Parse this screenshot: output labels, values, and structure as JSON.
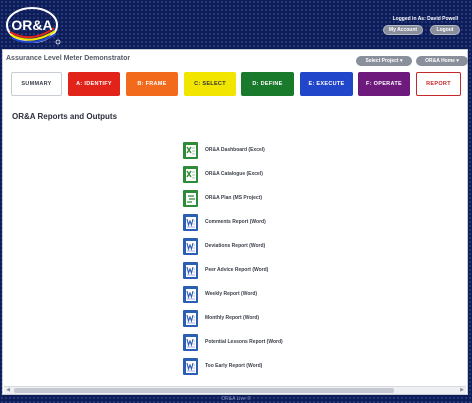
{
  "header": {
    "logo_text": "OR&A",
    "user_text": "Logged in As: David Powell",
    "my_account_label": "My Account",
    "logout_label": "Logout"
  },
  "panel": {
    "app_title": "Assurance Level Meter Demonstrator",
    "select_project_label": "Select Project ▾",
    "orla_home_label": "OR&A Home ▾"
  },
  "tabs": [
    {
      "label": "SUMMARY",
      "color": "#ffffff",
      "text_color": "#3a3f4a"
    },
    {
      "label": "A: IDENTIFY",
      "color": "#e2231a",
      "text_color": "#ffffff"
    },
    {
      "label": "B: FRAME",
      "color": "#f26a1b",
      "text_color": "#ffffff"
    },
    {
      "label": "C: SELECT",
      "color": "#f2e600",
      "text_color": "#333333"
    },
    {
      "label": "D: DEFINE",
      "color": "#1a7a2c",
      "text_color": "#ffffff"
    },
    {
      "label": "E: EXECUTE",
      "color": "#2146c9",
      "text_color": "#ffffff"
    },
    {
      "label": "F: OPERATE",
      "color": "#6e1a7d",
      "text_color": "#ffffff"
    },
    {
      "label": "REPORT",
      "color": "#ffffff",
      "text_color": "#c42828"
    }
  ],
  "section_title": "OR&A Reports and Outputs",
  "reports": [
    {
      "label": "OR&A Dashboard  (Excel)",
      "icon": "excel-icon"
    },
    {
      "label": "OR&A Catalogue  (Excel)",
      "icon": "excel-icon"
    },
    {
      "label": "OR&A Plan  (MS Project)",
      "icon": "project-icon"
    },
    {
      "label": "Comments Report  (Word)",
      "icon": "word-icon"
    },
    {
      "label": "Deviations Report  (Word)",
      "icon": "word-icon"
    },
    {
      "label": "Peer Advice Report  (Word)",
      "icon": "word-icon"
    },
    {
      "label": "Weekly Report  (Word)",
      "icon": "word-icon"
    },
    {
      "label": "Monthly Report  (Word)",
      "icon": "word-icon"
    },
    {
      "label": "Potential Lessons Report  (Word)",
      "icon": "word-icon"
    },
    {
      "label": "Too Early Report  (Word)",
      "icon": "word-icon"
    }
  ],
  "footer_text": "OR&A Live ©"
}
